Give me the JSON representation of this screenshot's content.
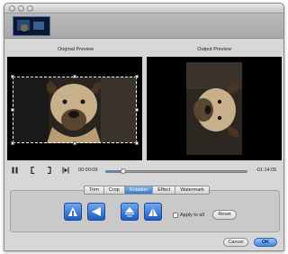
{
  "window": {
    "traffic_lights": [
      "close-icon",
      "minimize-icon",
      "zoom-icon"
    ]
  },
  "previews": {
    "original_label": "Original Preview",
    "output_label": "Output Preview"
  },
  "playback": {
    "buttons": [
      "pause-icon",
      "mark-in-icon",
      "mark-out-icon",
      "step-forward-icon"
    ],
    "elapsed": "00:00:09",
    "remaining": "-01:14:05",
    "progress": 0.12
  },
  "tabs": [
    {
      "label": "Trim",
      "active": false
    },
    {
      "label": "Crop",
      "active": false
    },
    {
      "label": "Rotation",
      "active": true
    },
    {
      "label": "Effect",
      "active": false
    },
    {
      "label": "Watermark",
      "active": false
    }
  ],
  "rotation": {
    "buttons": [
      "rotate-clockwise-icon",
      "rotate-counterclockwise-icon",
      "flip-vertical-icon",
      "flip-horizontal-icon"
    ],
    "apply_all_label": "Apply to all",
    "apply_all_checked": false,
    "reset_label": "Reset"
  },
  "footer": {
    "cancel_label": "Cancel",
    "ok_label": "OK"
  },
  "colors": {
    "accent": "#3b78cf",
    "preview_background": "#000000"
  }
}
